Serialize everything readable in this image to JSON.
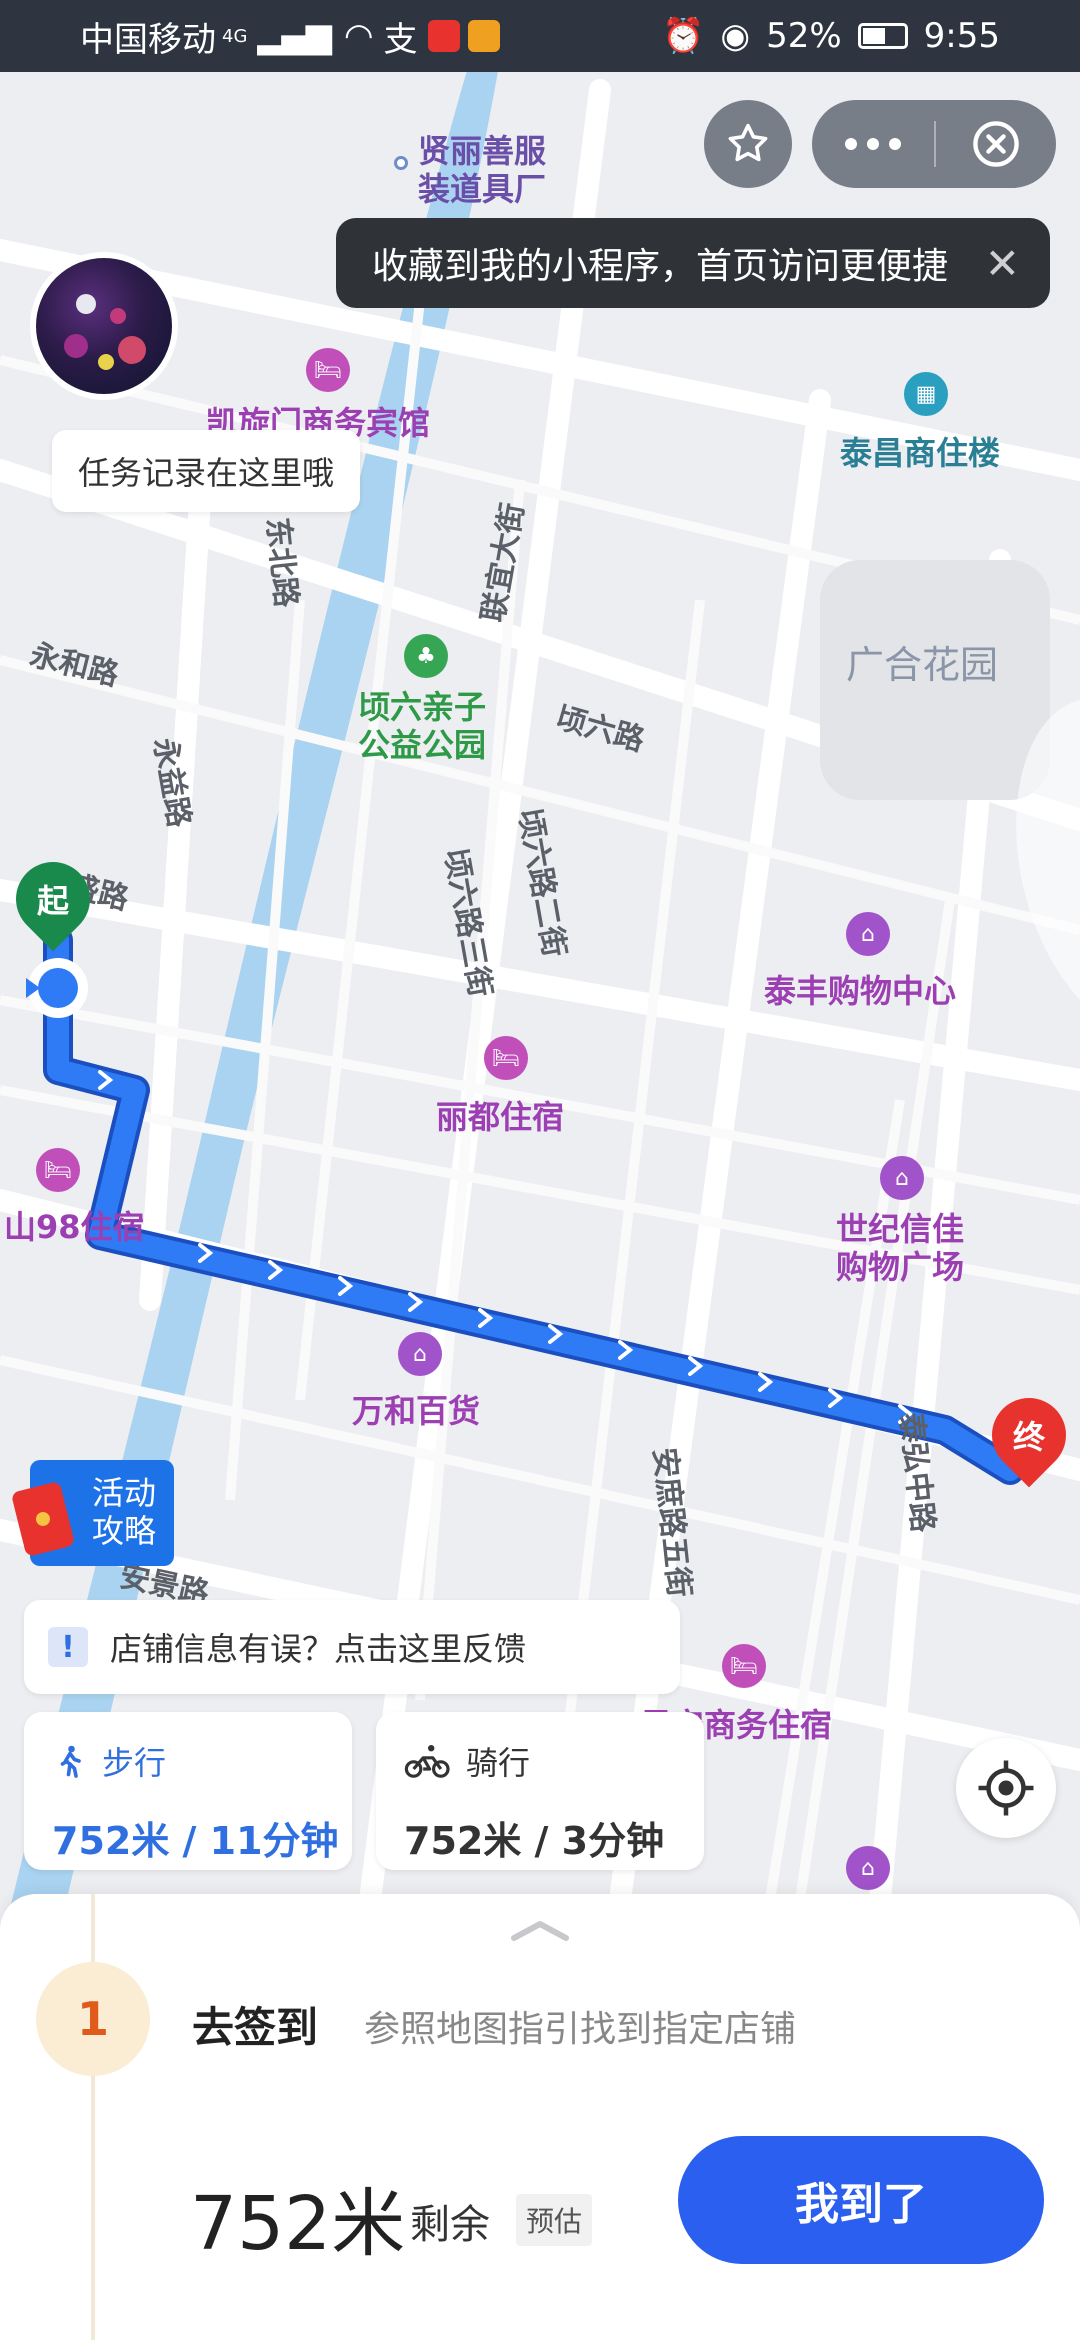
{
  "status_bar": {
    "carrier": "中国移动",
    "network": "4G",
    "battery": "52%",
    "time": "9:55"
  },
  "top_tip": {
    "text": "收藏到我的小程序，首页访问更便捷",
    "close": "✕"
  },
  "task_bubble": "任务记录在这里哦",
  "map": {
    "pois": {
      "top_factory_line1": "贤丽善服",
      "top_factory_line2": "装道具厂",
      "hotel_kaixuanmen": "凯旋门商务宾馆",
      "taichang": "泰昌商住楼",
      "guanghe": "广合花园",
      "park_line1": "顷六亲子",
      "park_line2": "公益公园",
      "taifeng": "泰丰购物中心",
      "lidu": "丽都住宿",
      "shijixinjia_line1": "世纪信佳",
      "shijixinjia_line2": "购物广场",
      "shan98": "山98住宿",
      "wanhe": "万和百货",
      "junan": "君安商务住宿"
    },
    "streets": {
      "yonghe": "永和路",
      "yongyi": "永益路",
      "hesheng": "合盛路",
      "lianyi": "联宜大街",
      "qingliu": "顷六路",
      "qingliu2": "顷六路二街",
      "qingliu3": "顷六路三街",
      "anshu": "安庶路五街",
      "taihong": "泰弘中路",
      "north": "东北路",
      "anjing": "安景路"
    },
    "start_marker": "起",
    "end_marker": "终"
  },
  "activity_button": {
    "line1": "活动",
    "line2": "攻略"
  },
  "feedback": {
    "icon": "!",
    "text": "店铺信息有误？点击这里反馈"
  },
  "modes": [
    {
      "label": "步行",
      "value": "752米 / 11分钟",
      "icon": "walk-icon"
    },
    {
      "label": "骑行",
      "value": "752米 / 3分钟",
      "icon": "bike-icon"
    }
  ],
  "step": {
    "number": "1",
    "title": "去签到",
    "description": "参照地图指引找到指定店铺"
  },
  "summary": {
    "distance": "752米",
    "remain": "剩余",
    "estimate": "预估"
  },
  "arrived_button": "我到了",
  "colors": {
    "accent": "#2a5ff0",
    "route": "#1f6ff0",
    "poi": "#9b3fb2",
    "start": "#1a8a4c",
    "end": "#e8322d"
  }
}
